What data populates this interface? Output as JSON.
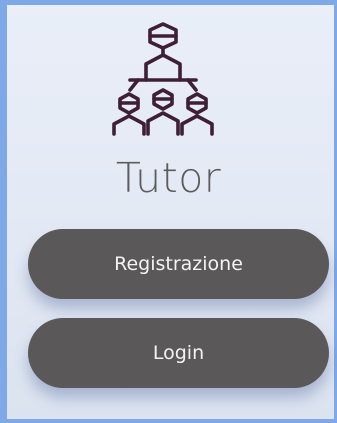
{
  "app": {
    "title": "Tutor",
    "logo_icon": "tutor-group-icon",
    "logo_color": "#3f1f36"
  },
  "actions": {
    "register_label": "Registrazione",
    "login_label": "Login"
  },
  "colors": {
    "background_border": "#7ea8e6",
    "panel": "#e6ecf6",
    "button": "#5a5858",
    "button_text": "#f3f3f3",
    "title_text": "#5c5c5c"
  }
}
